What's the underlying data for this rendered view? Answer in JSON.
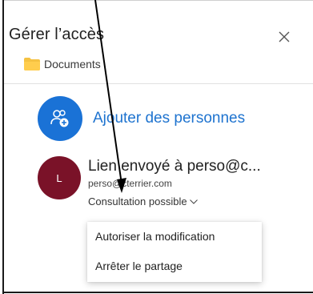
{
  "dialog": {
    "title": "Gérer l’accès",
    "folder": {
      "label": "Documents",
      "icon": "folder-icon",
      "color": "#f5c242"
    }
  },
  "add_people": {
    "label": "Ajouter des personnes",
    "icon": "add-people-icon",
    "accent": "#1a72d6"
  },
  "share_entry": {
    "avatar_initial": "L",
    "avatar_color": "#7a1228",
    "name": "Lien envoyé à perso@c...",
    "email": "perso@cterrier.com",
    "permission": "Consultation possible"
  },
  "permission_menu": {
    "items": [
      {
        "label": "Autoriser la modification"
      },
      {
        "label": "Arrêter le partage"
      }
    ]
  }
}
